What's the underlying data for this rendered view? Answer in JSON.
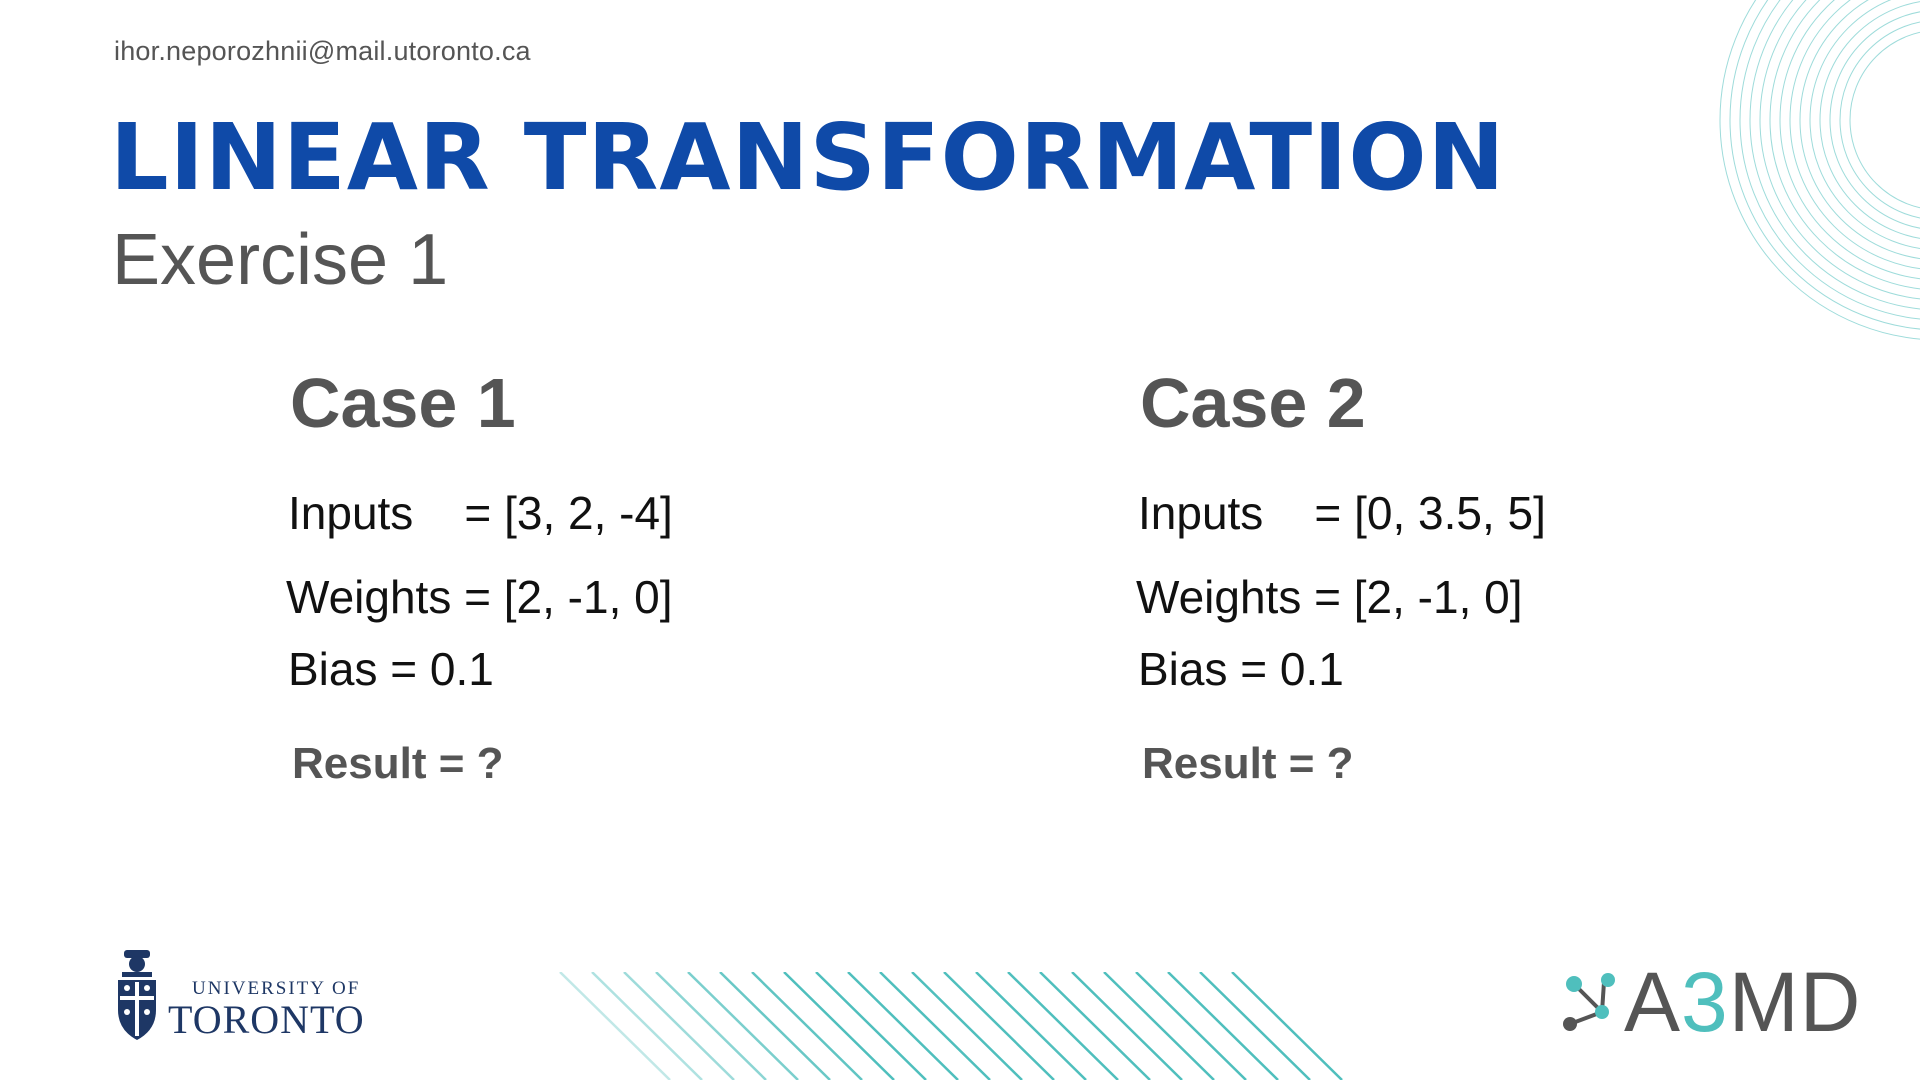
{
  "header": {
    "email": "ihor.neporozhnii@mail.utoronto.ca",
    "title": "LINEAR TRANSFORMATION",
    "subtitle": "Exercise 1"
  },
  "cases": [
    {
      "title": "Case 1",
      "inputs": "Inputs    = [3, 2, -4]",
      "weights": "Weights = [2, -1, 0]",
      "bias": "Bias = 0.1",
      "result": "Result = ?"
    },
    {
      "title": "Case 2",
      "inputs": "Inputs    = [0, 3.5, 5]",
      "weights": "Weights = [2, -1, 0]",
      "bias": "Bias = 0.1",
      "result": "Result = ?"
    }
  ],
  "footer": {
    "uoft_small": "UNIVERSITY OF",
    "uoft_big": "TORONTO",
    "a3md_prefix": "A",
    "a3md_three": "3",
    "a3md_suffix": "MD"
  },
  "colors": {
    "title": "#0f4aa8",
    "text": "#555555",
    "accent": "#4fbfbd",
    "uoft": "#1e3765"
  }
}
